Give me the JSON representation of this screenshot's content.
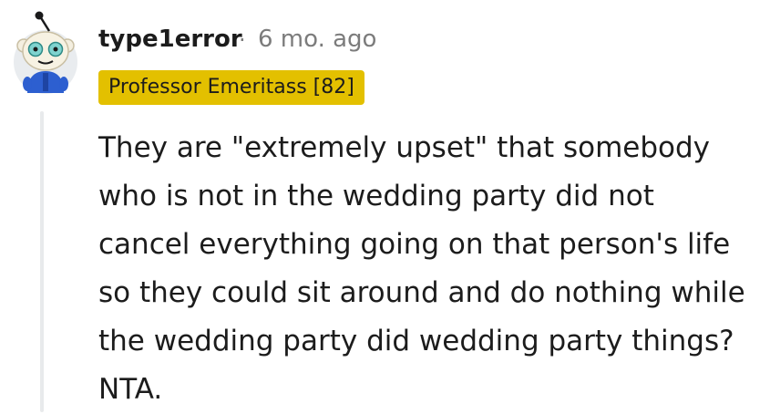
{
  "comment": {
    "author": "type1error",
    "separator": "·",
    "timestamp": "6 mo. ago",
    "flair": "Professor Emeritass [82]",
    "body": "They are \"extremely upset\" that somebody who is not in the wedding party did not cancel everything going on that person's life so they could sit around and do nothing while the wedding party did wedding party things? NTA."
  },
  "colors": {
    "flair_bg": "#e3c000",
    "thread_line": "#e8eaec",
    "meta_text": "#7c7c7c"
  },
  "icons": {
    "avatar": "snoo-avatar-icon"
  }
}
